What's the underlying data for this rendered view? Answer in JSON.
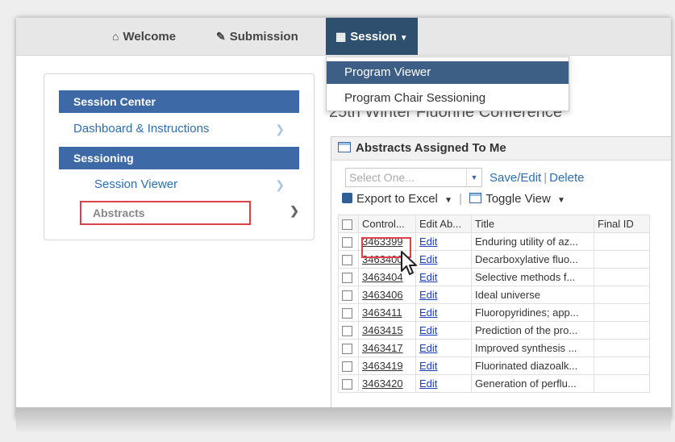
{
  "navbar": {
    "welcome": {
      "label": "Welcome",
      "icon": "home-icon"
    },
    "submission": {
      "label": "Submission",
      "icon": "pencil-icon"
    },
    "session": {
      "label": "Session",
      "icon": "calendar-icon"
    }
  },
  "dropdown": {
    "items": [
      {
        "label": "Program Viewer",
        "active": true
      },
      {
        "label": "Program Chair Sessioning",
        "active": false
      }
    ]
  },
  "sidebar": {
    "session_center": "Session Center",
    "dashboard": "Dashboard & Instructions",
    "sessioning": "Sessioning",
    "session_viewer": "Session Viewer",
    "abstracts": "Abstracts"
  },
  "conference_title": "25th Winter Fluorine Conference",
  "abstracts_panel": {
    "heading": "Abstracts Assigned To Me",
    "select_placeholder": "Select One...",
    "save_edit": "Save/Edit",
    "delete": "Delete",
    "export": "Export to Excel",
    "toggle_view": "Toggle View",
    "columns": [
      "Control...",
      "Edit Ab...",
      "Title",
      "Final ID"
    ],
    "rows": [
      {
        "control": "3463399",
        "edit": "Edit",
        "title": "Enduring utility of az..."
      },
      {
        "control": "3463400",
        "edit": "Edit",
        "title": "Decarboxylative fluo..."
      },
      {
        "control": "3463404",
        "edit": "Edit",
        "title": "Selective methods f..."
      },
      {
        "control": "3463406",
        "edit": "Edit",
        "title": "Ideal universe"
      },
      {
        "control": "3463411",
        "edit": "Edit",
        "title": "Fluoropyridines; app..."
      },
      {
        "control": "3463415",
        "edit": "Edit",
        "title": "Prediction of the pro..."
      },
      {
        "control": "3463417",
        "edit": "Edit",
        "title": "Improved synthesis ..."
      },
      {
        "control": "3463419",
        "edit": "Edit",
        "title": "Fluorinated diazoalk..."
      },
      {
        "control": "3463420",
        "edit": "Edit",
        "title": "Generation of perflu..."
      }
    ]
  },
  "colors": {
    "nav_active": "#2f4f6f",
    "panel_header": "#3d6aa6",
    "dropdown_active": "#3d5f86",
    "highlight": "#e0404a",
    "link": "#2a6fb5"
  }
}
